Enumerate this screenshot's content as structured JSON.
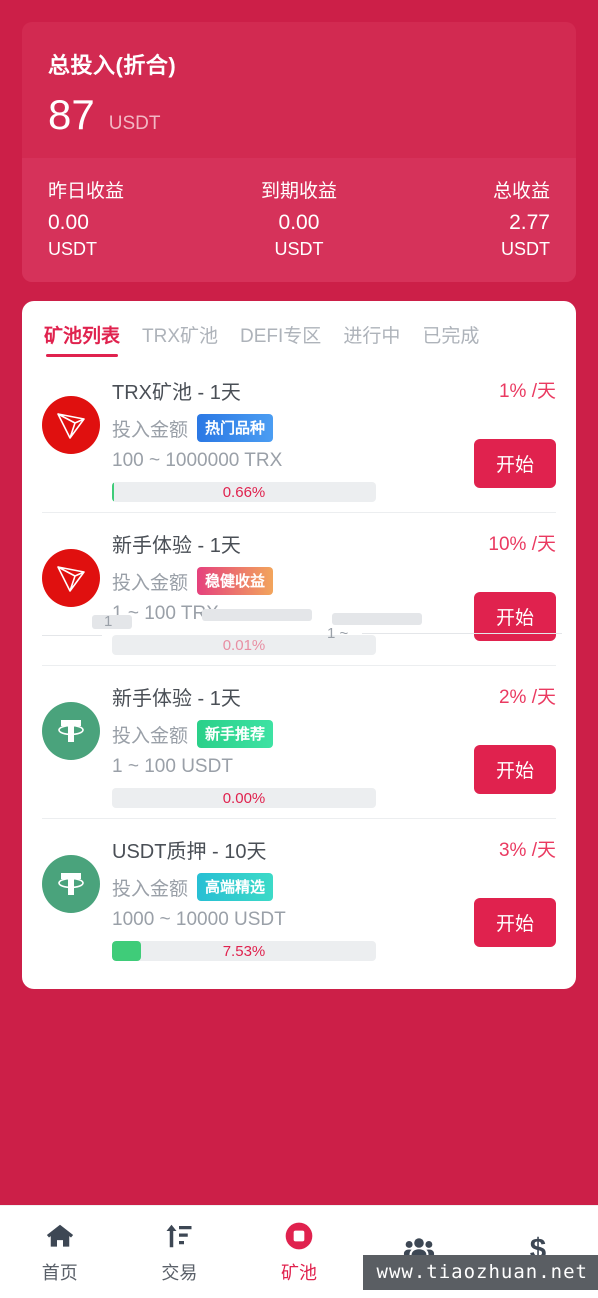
{
  "colors": {
    "page_background": "#cc1f48",
    "panel": "#d22a51",
    "stats_panel": "#d6325a",
    "accent": "#e0224e",
    "rate_text": "#ea3a61",
    "progress_track": "#eceef0",
    "progress_fill": "#3fcc79",
    "trx_coin": "#e0100f",
    "usdt_coin": "#4aa37c",
    "muted_text": "#9aa0a8",
    "tab_inactive": "#aeb3ba"
  },
  "header": {
    "balance_title": "总投入(折合)",
    "balance_value": "87",
    "balance_unit": "USDT",
    "stats": [
      {
        "label": "昨日收益",
        "value": "0.00",
        "unit": "USDT"
      },
      {
        "label": "到期收益",
        "value": "0.00",
        "unit": "USDT"
      },
      {
        "label": "总收益",
        "value": "2.77",
        "unit": "USDT"
      }
    ]
  },
  "tabs": [
    {
      "label": "矿池列表",
      "active": true
    },
    {
      "label": "TRX矿池",
      "active": false
    },
    {
      "label": "DEFI专区",
      "active": false
    },
    {
      "label": "进行中",
      "active": false
    },
    {
      "label": "已完成",
      "active": false
    }
  ],
  "pools": [
    {
      "icon": "trx-coin-icon",
      "title": "TRX矿池 - 1天",
      "amount_label": "投入金额",
      "badge": "热门品种",
      "badge_color": "blue",
      "range": "100 ~ 1000000 TRX",
      "progress_text": "0.66%",
      "progress_percent": 0.66,
      "rate": "1% /天",
      "button": "开始"
    },
    {
      "icon": "trx-coin-icon",
      "title": "新手体验 - 1天",
      "amount_label": "投入金额",
      "badge": "稳健收益",
      "badge_color": "pink",
      "range": "1 ~ 100 TRX",
      "progress_text": "0.01%",
      "progress_percent": 0.01,
      "rate": "10% /天",
      "button": "开始"
    },
    {
      "icon": "usdt-coin-icon",
      "title": "新手体验 - 1天",
      "amount_label": "投入金额",
      "badge": "新手推荐",
      "badge_color": "green",
      "range": "1 ~ 100 USDT",
      "progress_text": "0.00%",
      "progress_percent": 0,
      "rate": "2% /天",
      "button": "开始"
    },
    {
      "icon": "usdt-coin-icon",
      "title": "USDT质押 - 10天",
      "amount_label": "投入金额",
      "badge": "高端精选",
      "badge_color": "cyan",
      "range": "1000 ~ 10000 USDT",
      "progress_text": "7.53%",
      "progress_percent": 7.53,
      "rate": "3% /天",
      "button": "开始"
    }
  ],
  "render_artifacts": {
    "fragment_one": "1",
    "fragment_two": "1 ~"
  },
  "bottom_nav": [
    {
      "label": "首页",
      "icon": "home-icon",
      "active": false
    },
    {
      "label": "交易",
      "icon": "trade-icon",
      "active": false
    },
    {
      "label": "矿池",
      "icon": "pool-icon",
      "active": true
    },
    {
      "label": "",
      "icon": "team-icon",
      "active": false
    },
    {
      "label": "",
      "icon": "dollar-icon",
      "active": false
    }
  ],
  "watermark": "www.tiaozhuan.net"
}
